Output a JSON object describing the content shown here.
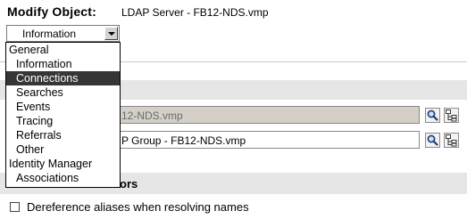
{
  "header": {
    "label": "Modify Object:",
    "object_name": "LDAP Server - FB12-NDS.vmp"
  },
  "tab_select": {
    "value": "Information"
  },
  "dropdown": {
    "items": [
      {
        "label": "General",
        "level": 0,
        "selected": false
      },
      {
        "label": "Information",
        "level": 1,
        "selected": false
      },
      {
        "label": "Connections",
        "level": 1,
        "selected": true
      },
      {
        "label": "Searches",
        "level": 1,
        "selected": false
      },
      {
        "label": "Events",
        "level": 1,
        "selected": false
      },
      {
        "label": "Tracing",
        "level": 1,
        "selected": false
      },
      {
        "label": "Referrals",
        "level": 1,
        "selected": false
      },
      {
        "label": "Other",
        "level": 1,
        "selected": false
      },
      {
        "label": "Identity Manager",
        "level": 0,
        "selected": false
      },
      {
        "label": "Associations",
        "level": 1,
        "selected": false
      }
    ]
  },
  "fields": {
    "field1_visible_text": "12-NDS.vmp",
    "field2_visible_text": "P Group - FB12-NDS.vmp"
  },
  "section2": {
    "visible_text": "ors"
  },
  "options": {
    "dereference_label": "Dereference aliases when resolving names",
    "dereference_checked": false
  },
  "colors": {
    "selection_bg": "#363636",
    "band_bg": "#e6e6e6",
    "disabled_field_bg": "#d4d0c8"
  },
  "icons": {
    "search": "magnifier-icon",
    "browse": "object-browser-icon"
  }
}
